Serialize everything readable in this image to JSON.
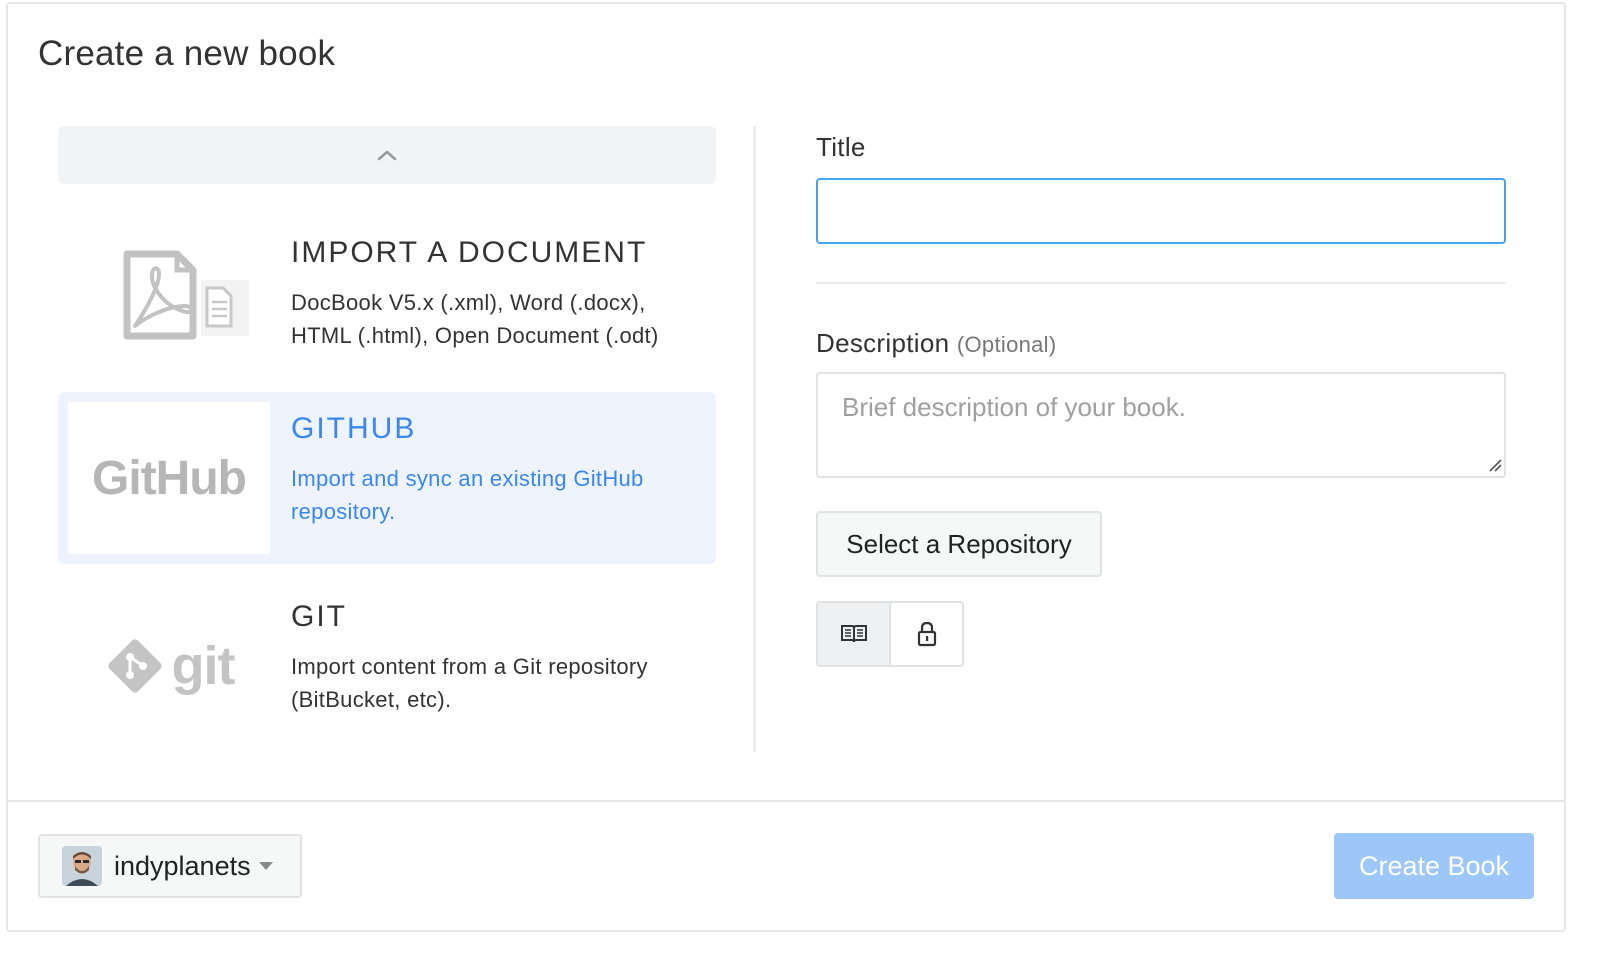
{
  "modal": {
    "title": "Create a new book"
  },
  "import_options": [
    {
      "title": "IMPORT A DOCUMENT",
      "description": "DocBook V5.x (.xml), Word (.docx), HTML (.html), Open Document (.odt)",
      "icon": "pdf-document-icon"
    },
    {
      "title": "GITHUB",
      "description": "Import and sync an existing GitHub repository.",
      "logo_text": "GitHub",
      "selected": true
    },
    {
      "title": "GIT",
      "description": "Import content from a Git repository (BitBucket, etc).",
      "logo_text": "git"
    }
  ],
  "form": {
    "title_label": "Title",
    "title_value": "",
    "description_label": "Description",
    "description_optional": "(Optional)",
    "description_placeholder": "Brief description of your book.",
    "select_repo_label": "Select a Repository",
    "visibility_options": [
      "book-icon",
      "lock-icon"
    ]
  },
  "footer": {
    "owner": "indyplanets",
    "create_label": "Create Book"
  },
  "colors": {
    "accent": "#3b87f0",
    "selected_bg": "#eef3fd",
    "primary_disabled": "#9dc7f8",
    "input_focus": "#47a3ef"
  }
}
